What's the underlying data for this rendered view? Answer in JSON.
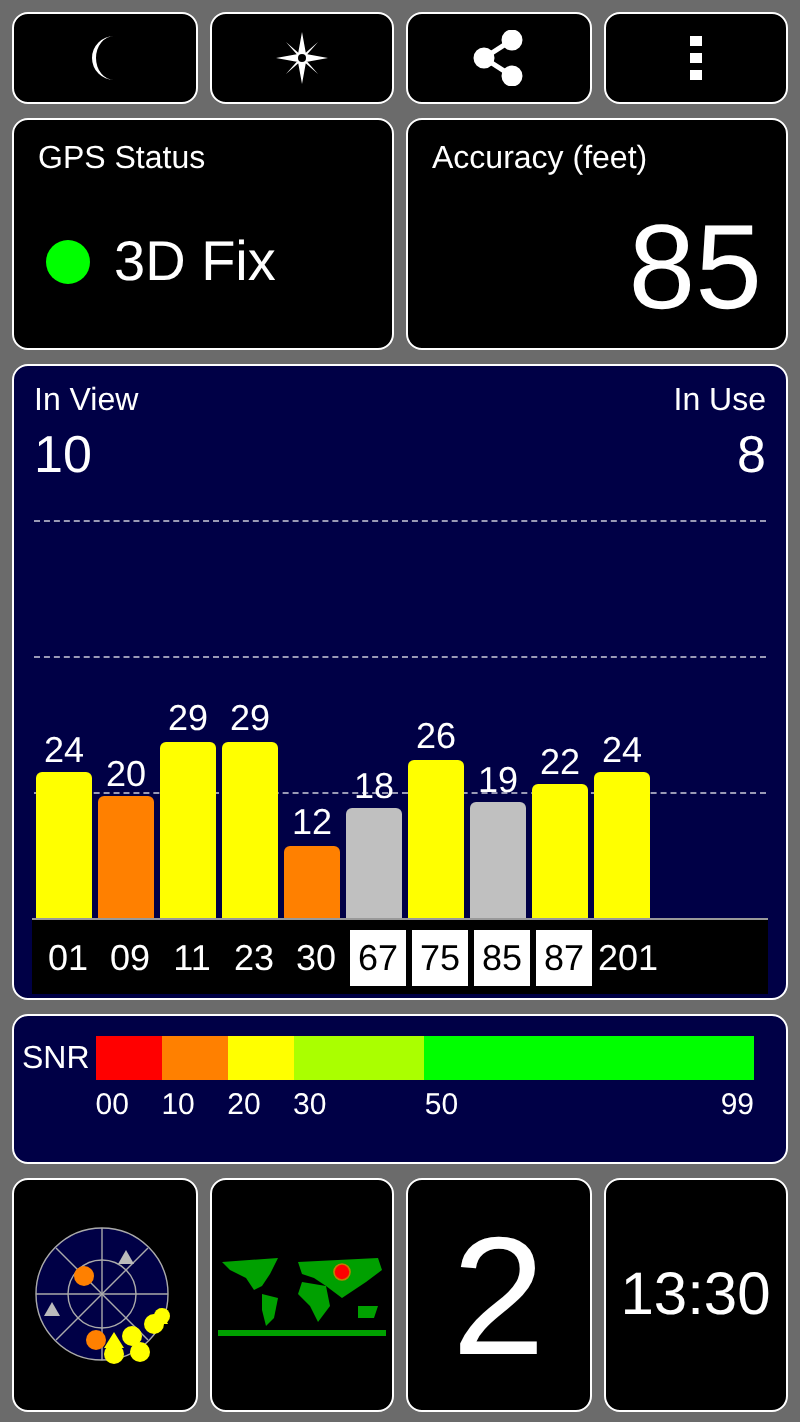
{
  "toolbar": [
    {
      "kind": "night"
    },
    {
      "kind": "compass"
    },
    {
      "kind": "share"
    },
    {
      "kind": "more"
    }
  ],
  "gps_status": {
    "title": "GPS Status",
    "value": "3D Fix",
    "color": "#00ff00"
  },
  "accuracy": {
    "title": "Accuracy (feet)",
    "value": "85"
  },
  "satellites_panel": {
    "in_view_label": "In View",
    "in_view": "10",
    "in_use_label": "In Use",
    "in_use": "8",
    "satellites": [
      {
        "id": "01",
        "snr": "24",
        "color": "#ffff00",
        "highlighted": false
      },
      {
        "id": "09",
        "snr": "20",
        "color": "#ff8000",
        "highlighted": false
      },
      {
        "id": "11",
        "snr": "29",
        "color": "#ffff00",
        "highlighted": false
      },
      {
        "id": "23",
        "snr": "29",
        "color": "#ffff00",
        "highlighted": false
      },
      {
        "id": "30",
        "snr": "12",
        "color": "#ff8000",
        "highlighted": false
      },
      {
        "id": "67",
        "snr": "18",
        "color": "#c0c0c0",
        "highlighted": true
      },
      {
        "id": "75",
        "snr": "26",
        "color": "#ffff00",
        "highlighted": true
      },
      {
        "id": "85",
        "snr": "19",
        "color": "#c0c0c0",
        "highlighted": true
      },
      {
        "id": "87",
        "snr": "22",
        "color": "#ffff00",
        "highlighted": true
      },
      {
        "id": "201",
        "snr": "24",
        "color": "#ffff00",
        "highlighted": false
      }
    ]
  },
  "snr_legend": {
    "label": "SNR",
    "segments": [
      {
        "tick": "00",
        "color": "#ff0000"
      },
      {
        "tick": "10",
        "color": "#ff8000"
      },
      {
        "tick": "20",
        "color": "#ffff00"
      },
      {
        "tick": "30",
        "color": "#aaff00"
      },
      {
        "tick": "50",
        "color": "#00ff00"
      }
    ],
    "end_tick": "99"
  },
  "tiles": [
    {
      "kind": "sky_plot"
    },
    {
      "kind": "world_map"
    },
    {
      "kind": "number",
      "value": "2"
    },
    {
      "kind": "clock",
      "value": "13:30"
    }
  ]
}
